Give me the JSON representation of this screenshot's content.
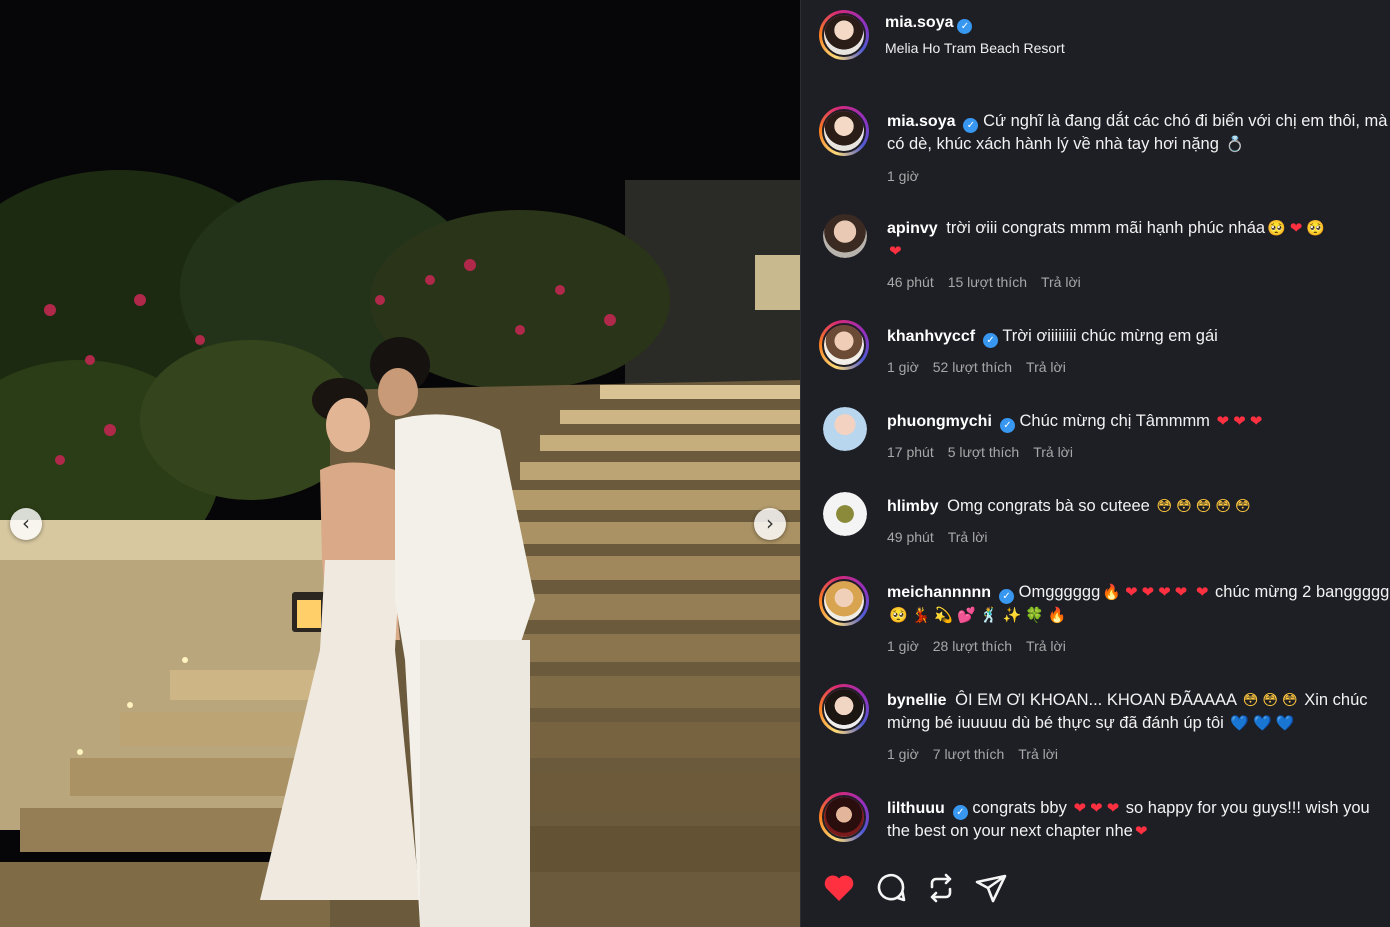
{
  "post": {
    "author": "mia.soya",
    "location": "Melia Ho Tram Beach Resort"
  },
  "caption": {
    "username": "mia.soya",
    "text": "Cứ nghĩ là đang dắt các chó đi biển với chị em thôi, mà có dè, khúc xách hành lý về nhà tay hơi nặng",
    "emoji": "💍",
    "time": "1 giờ"
  },
  "comments": [
    {
      "username": "apinvy",
      "verified": false,
      "text": "trời ơiii congrats mmm mãi hạnh phúc nháa",
      "emojis": [
        "🥺",
        "❤",
        "🥺",
        "❤"
      ],
      "time": "46 phút",
      "likes": "15 lượt thích",
      "reply": "Trả lời"
    },
    {
      "username": "khanhvyccf",
      "verified": true,
      "text": "Trời ơiiiiiiii chúc mừng em gái",
      "emojis": [],
      "time": "1 giờ",
      "likes": "52 lượt thích",
      "reply": "Trả lời"
    },
    {
      "username": "phuongmychi",
      "verified": true,
      "text": "Chúc mừng chị Tâmmmm",
      "emojis": [
        "❤",
        "❤",
        "❤"
      ],
      "time": "17 phút",
      "likes": "5 lượt thích",
      "reply": "Trả lời"
    },
    {
      "username": "hlimby",
      "verified": false,
      "text": "Omg congrats bà so cuteee",
      "emojis": [
        "😳",
        "😳",
        "😳",
        "😳",
        "😳"
      ],
      "time": "49 phút",
      "likes": "",
      "reply": "Trả lời"
    },
    {
      "username": "meichannnnn",
      "verified": true,
      "text_before": "Omgggggg",
      "emojis_mid": [
        "🔥",
        "❤",
        "❤",
        "❤",
        "❤",
        "❤"
      ],
      "text_after": "chúc mừng 2 banggggg",
      "emojis_end": [
        "🥺",
        "💃",
        "💫",
        "💕",
        "🕺",
        "✨",
        "🍀",
        "🔥"
      ],
      "time": "1 giờ",
      "likes": "28 lượt thích",
      "reply": "Trả lời"
    },
    {
      "username": "bynellie",
      "verified": false,
      "text_before": "ÔI EM ƠI KHOAN... KHOAN ĐÃAAAA",
      "emojis_mid": [
        "😳",
        "😳",
        "😳"
      ],
      "text_after": "Xin chúc mừng bé iuuuuu dù bé thực sự đã đánh úp tôi",
      "emojis_end": [
        "💙",
        "💙",
        "💙"
      ],
      "time": "1 giờ",
      "likes": "7 lượt thích",
      "reply": "Trả lời"
    },
    {
      "username": "lilthuuu",
      "verified": true,
      "text_before": "congrats bby",
      "emojis_mid": [
        "❤",
        "❤",
        "❤"
      ],
      "text_after": "so happy for you guys!!! wish you the best on your next chapter nhe",
      "emojis_end": [
        "❤"
      ]
    }
  ],
  "icons": {
    "like": "heart-icon-filled",
    "comment": "comment-bubble-icon",
    "repost": "repost-icon",
    "share": "paper-plane-icon",
    "prev": "chevron-left-icon",
    "next": "chevron-right-icon",
    "verified": "verified-badge-icon"
  },
  "colors": {
    "panel_bg": "#1e1e25",
    "like_red": "#ff3040",
    "verified_blue": "#3897f0",
    "meta_gray": "#a8a8a8"
  },
  "glyphs": {
    "prev": "‹",
    "next": "›",
    "check": "✓"
  }
}
